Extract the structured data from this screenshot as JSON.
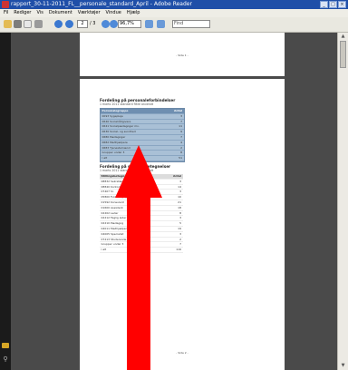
{
  "window": {
    "title": "rapport_30-11-2011_FL__personale_standard_April - Adobe Reader"
  },
  "menu": [
    "Fil",
    "Rediger",
    "Vis",
    "Dokument",
    "Værktøjer",
    "Vindue",
    "Hjælp"
  ],
  "toolbar": {
    "page_current": "2",
    "page_total": "/ 3",
    "zoom": "96,7%",
    "find_placeholder": "Find"
  },
  "page1": {
    "footer": "- Side 1 -"
  },
  "page2": {
    "section1": {
      "title": "Fordeling på personaleforbindelser",
      "subtitle": "1 marts 2011 standard filtre anvendt"
    },
    "table1": {
      "headers": [
        "Personalegruppe",
        "Antal"
      ],
      "rows": [
        [
          "0093 Sygepleje",
          "3"
        ],
        [
          "0640 Socialrådgivere",
          "7"
        ],
        [
          "0641 Socialpædagoger mv.",
          "11"
        ],
        [
          "0630 Social- og sundhed",
          "9"
        ],
        [
          "0680 Pædagoger",
          "7"
        ],
        [
          "0682 Medhjælpere",
          "4"
        ],
        [
          "0683 Tjenestemænd",
          "2"
        ],
        [
          "Grupper under 3",
          "8"
        ]
      ],
      "total": [
        "I alt",
        "51"
      ]
    },
    "section2": {
      "title": "Fordeling på stillingsbetegnelser",
      "subtitle": "1 marts 2011 standard filtre anvendt"
    },
    "table2": {
      "headers": [
        "Stillingsbetegnelse",
        "Antal"
      ],
      "rows": [
        [
          "08832 Sekretær",
          "3"
        ],
        [
          "08840 Kontormedhjælper",
          "14"
        ],
        [
          "07407 Sr.",
          "3"
        ],
        [
          "05800 Fuldmægtig",
          "10"
        ],
        [
          "01592 Konsulent",
          "21"
        ],
        [
          "01600 Assistent",
          "18"
        ],
        [
          "02202 Leder",
          "8"
        ],
        [
          "02212 Faglig leder",
          "3"
        ],
        [
          "02210 Pædagog",
          "5"
        ],
        [
          "04011 Medhjælper",
          "19"
        ],
        [
          "04005 Specialist",
          "3"
        ],
        [
          "07213 Studerende",
          "2"
        ],
        [
          "Grupper under 3",
          "7"
        ]
      ],
      "total": [
        "I alt",
        "116"
      ]
    },
    "footer": "- Side 2 -"
  },
  "colors": {
    "title_bar": "#1f4fa8",
    "annotation_arrow": "#ff0000",
    "document_background": "#4a4a4a"
  },
  "annotation": {
    "type": "arrow",
    "color": "#ff0000",
    "points_to": "table1"
  }
}
